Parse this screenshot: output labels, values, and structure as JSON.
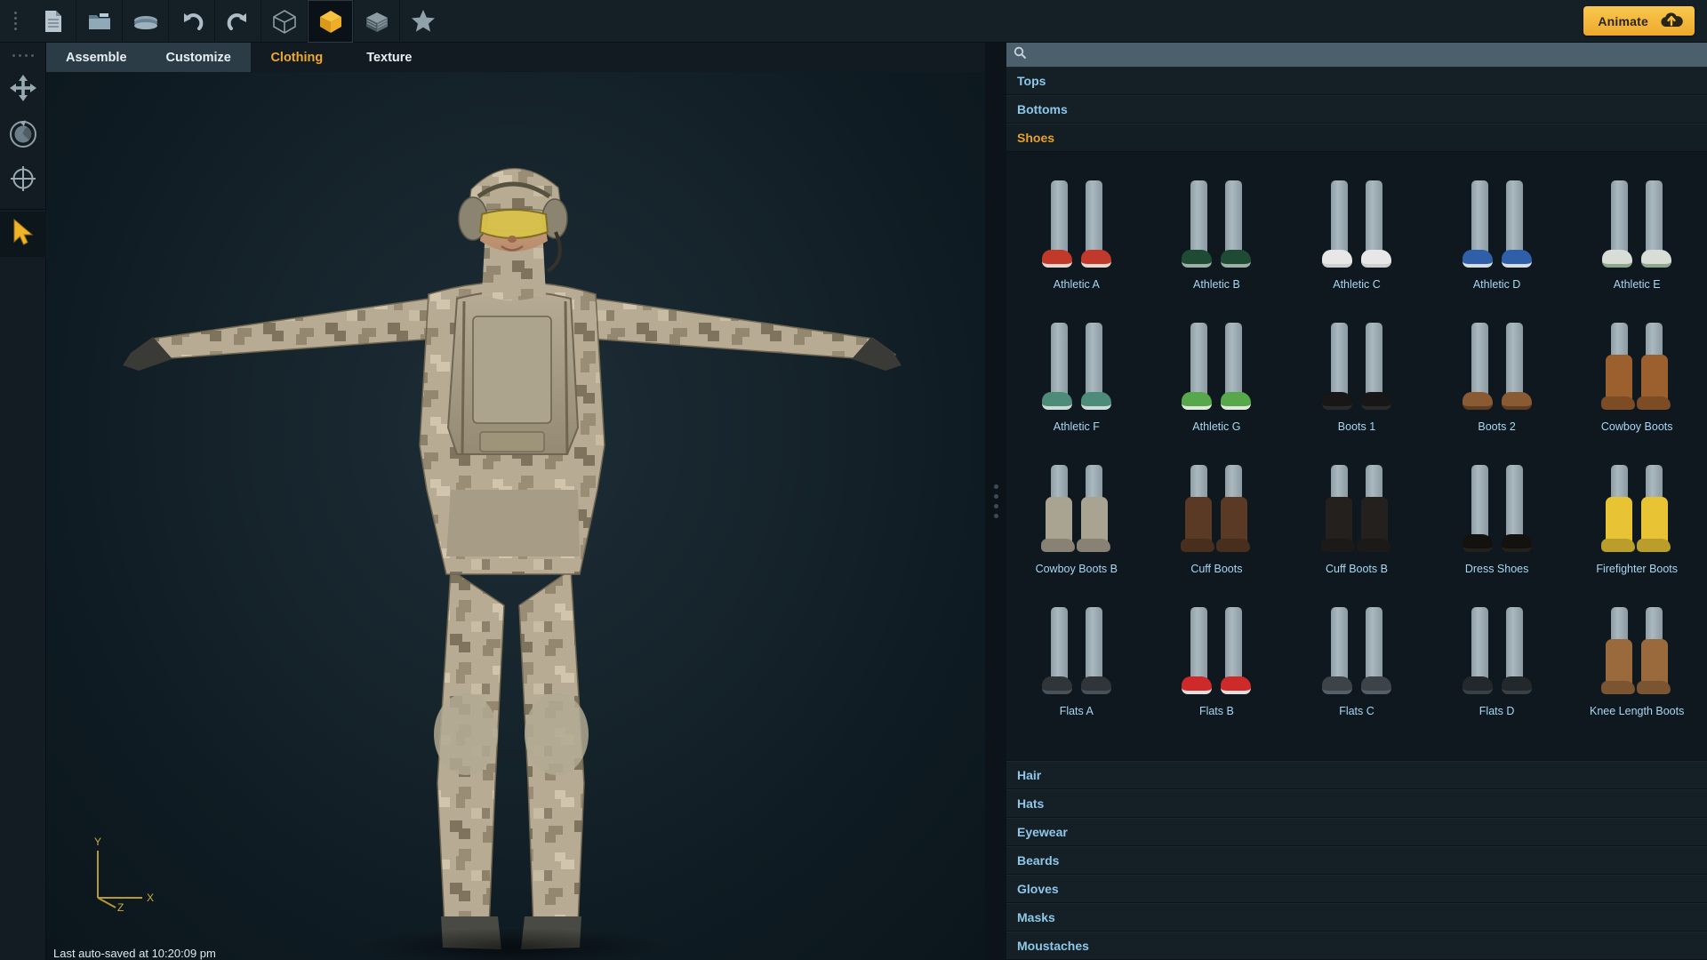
{
  "app": {
    "accent_orange": "#e8a02a",
    "accent_blue": "#8fc7e8",
    "panel_bg": "#101b21",
    "viewport_bg": "#16242c"
  },
  "toolbar": {
    "grip": "drag-handle",
    "buttons": [
      {
        "name": "new-document",
        "icon": "document-icon",
        "active": false
      },
      {
        "name": "open-folder",
        "icon": "folder-icon",
        "active": false
      },
      {
        "name": "save",
        "icon": "save-disk-icon",
        "active": false
      },
      {
        "name": "undo",
        "icon": "undo-arrow-icon",
        "active": false
      },
      {
        "name": "redo",
        "icon": "redo-arrow-icon",
        "active": false
      },
      {
        "name": "view-wireframe",
        "icon": "cube-wireframe-icon",
        "active": false
      },
      {
        "name": "view-shaded",
        "icon": "cube-solid-icon",
        "active": true
      },
      {
        "name": "view-textured",
        "icon": "cube-textured-icon",
        "active": false
      },
      {
        "name": "favorites",
        "icon": "star-icon",
        "active": false
      }
    ],
    "animate": {
      "label": "Animate",
      "icon": "cloud-upload-icon"
    }
  },
  "left_rail": {
    "grip": "drag-handle",
    "tools": [
      {
        "name": "move-tool",
        "icon": "four-arrows-move-icon",
        "active": false
      },
      {
        "name": "rotate-tool",
        "icon": "rotate-sphere-icon",
        "active": false
      },
      {
        "name": "scale-tool",
        "icon": "crosshair-target-icon",
        "active": false
      },
      {
        "name": "select-tool",
        "icon": "cursor-arrow-icon",
        "active": true
      }
    ]
  },
  "viewport": {
    "tabs": [
      {
        "label": "Assemble",
        "active": false
      },
      {
        "label": "Customize",
        "active": false
      },
      {
        "label": "Clothing",
        "active": true
      },
      {
        "label": "Texture",
        "active": false
      }
    ],
    "axis_gizmo": {
      "x": "X",
      "y": "Y",
      "z": "Z",
      "color": "#b59a30"
    },
    "status": "Last auto-saved at 10:20:09 pm",
    "character": {
      "description": "Female soldier character in A-pose wearing desert digital camouflage uniform, tactical vest, cap with headset, yellow-tinted goggles and knee pads"
    }
  },
  "splitter": {
    "name": "panel-resize-handle"
  },
  "panel": {
    "search": {
      "value": "",
      "placeholder": "",
      "icon": "search-icon"
    },
    "categories_top": [
      {
        "label": "Tops",
        "active": false
      },
      {
        "label": "Bottoms",
        "active": false
      },
      {
        "label": "Shoes",
        "active": true
      }
    ],
    "categories_bottom": [
      {
        "label": "Hair",
        "active": false
      },
      {
        "label": "Hats",
        "active": false
      },
      {
        "label": "Eyewear",
        "active": false
      },
      {
        "label": "Beards",
        "active": false
      },
      {
        "label": "Gloves",
        "active": false
      },
      {
        "label": "Masks",
        "active": false
      },
      {
        "label": "Moustaches",
        "active": false
      }
    ],
    "items": [
      {
        "label": "Athletic A",
        "kind": "shoe",
        "color": "#c0392b",
        "sole": "#e8d9d0"
      },
      {
        "label": "Athletic B",
        "kind": "shoe",
        "color": "#1f4a33",
        "sole": "#9fb0a4"
      },
      {
        "label": "Athletic C",
        "kind": "shoe",
        "color": "#e7e7e7",
        "sole": "#cfcfcf"
      },
      {
        "label": "Athletic D",
        "kind": "shoe",
        "color": "#2f5fa8",
        "sole": "#d8dde4"
      },
      {
        "label": "Athletic E",
        "kind": "shoe",
        "color": "#d8ded6",
        "sole": "#8ea88c"
      },
      {
        "label": "Athletic F",
        "kind": "shoe",
        "color": "#4e8c7a",
        "sole": "#cfdcd6"
      },
      {
        "label": "Athletic G",
        "kind": "shoe",
        "color": "#57a84b",
        "sole": "#dfe9dc"
      },
      {
        "label": "Boots 1",
        "kind": "shoe",
        "color": "#171717",
        "sole": "#2a2a2a"
      },
      {
        "label": "Boots 2",
        "kind": "shoe",
        "color": "#8a5a32",
        "sole": "#5e3d22"
      },
      {
        "label": "Cowboy Boots",
        "kind": "boot",
        "color": "#9c5f2e",
        "sole": "#6b4020"
      },
      {
        "label": "Cowboy Boots B",
        "kind": "boot",
        "color": "#a9a391",
        "sole": "#6e6a5c"
      },
      {
        "label": "Cuff Boots",
        "kind": "boot",
        "color": "#5a3a24",
        "sole": "#cbbfae"
      },
      {
        "label": "Cuff Boots B",
        "kind": "boot",
        "color": "#23201e",
        "sole": "#3a3633"
      },
      {
        "label": "Dress Shoes",
        "kind": "shoe",
        "color": "#14120f",
        "sole": "#24211d"
      },
      {
        "label": "Firefighter Boots",
        "kind": "boot",
        "color": "#e8c434",
        "sole": "#1c1c1c"
      },
      {
        "label": "Flats A",
        "kind": "shoe",
        "color": "#30353a",
        "sole": "#4a5259"
      },
      {
        "label": "Flats B",
        "kind": "shoe",
        "color": "#cf2a2a",
        "sole": "#e0e0e0"
      },
      {
        "label": "Flats C",
        "kind": "shoe",
        "color": "#3c4349",
        "sole": "#565f66"
      },
      {
        "label": "Flats D",
        "kind": "shoe",
        "color": "#23282c",
        "sole": "#3a4146"
      },
      {
        "label": "Knee Length Boots",
        "kind": "boot",
        "color": "#9a6a3d",
        "sole": "#6a472a"
      }
    ]
  }
}
